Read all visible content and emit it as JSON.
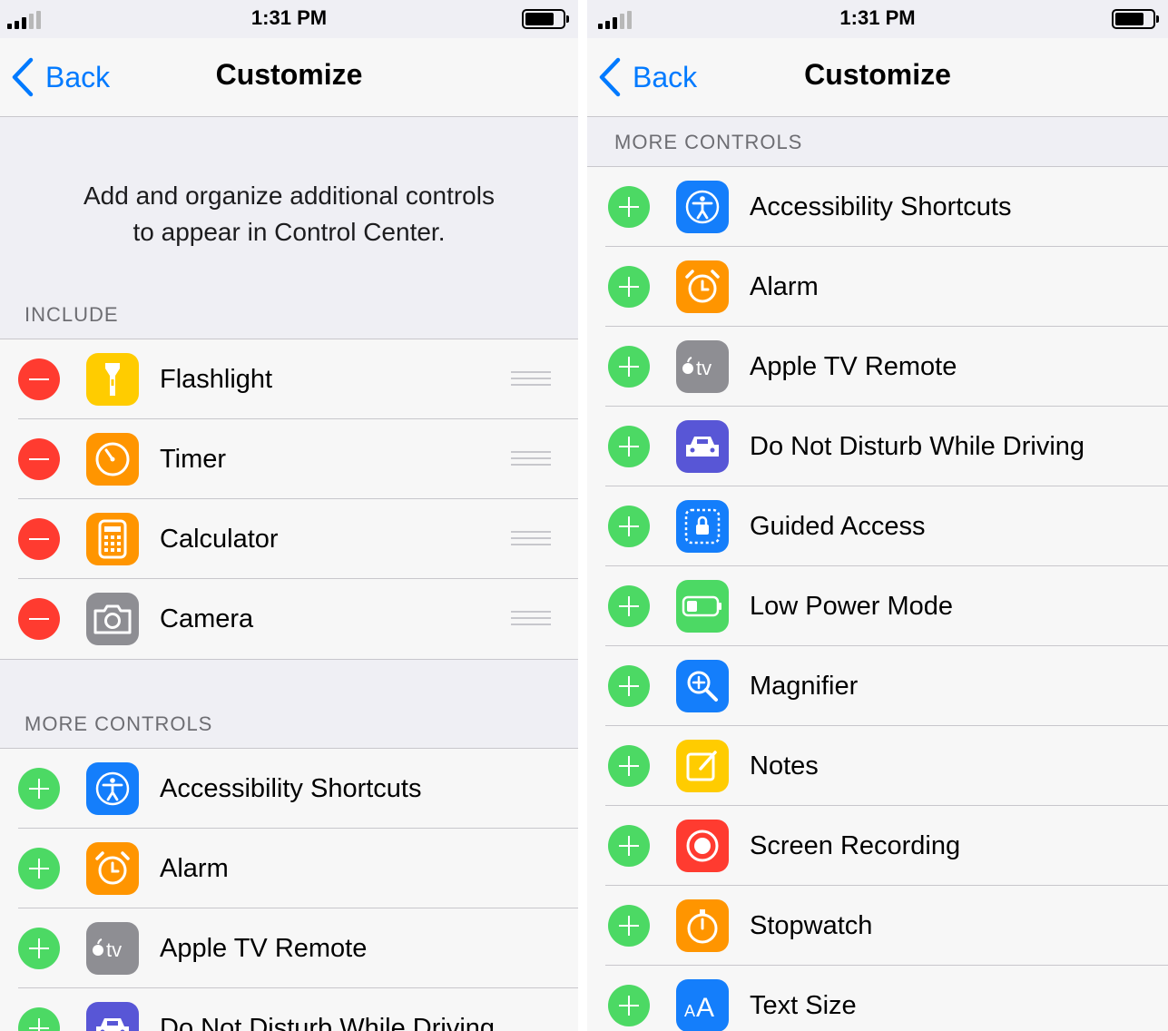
{
  "colors": {
    "accent": "#007aff",
    "remove": "#ff3b30",
    "add": "#4cd964"
  },
  "left": {
    "status": {
      "time": "1:31 PM"
    },
    "nav": {
      "back": "Back",
      "title": "Customize"
    },
    "intro": [
      "Add and organize additional controls",
      "to appear in Control Center."
    ],
    "include_header": "INCLUDE",
    "include": [
      {
        "label": "Flashlight",
        "icon": "flashlight-icon"
      },
      {
        "label": "Timer",
        "icon": "timer-icon"
      },
      {
        "label": "Calculator",
        "icon": "calculator-icon"
      },
      {
        "label": "Camera",
        "icon": "camera-icon"
      }
    ],
    "more_header": "MORE CONTROLS",
    "more": [
      {
        "label": "Accessibility Shortcuts",
        "icon": "accessibility-icon"
      },
      {
        "label": "Alarm",
        "icon": "alarm-icon"
      },
      {
        "label": "Apple TV Remote",
        "icon": "apple-tv-icon"
      },
      {
        "label": "Do Not Disturb While Driving",
        "icon": "car-icon"
      }
    ]
  },
  "right": {
    "status": {
      "time": "1:31 PM"
    },
    "nav": {
      "back": "Back",
      "title": "Customize"
    },
    "more_header": "MORE CONTROLS",
    "more": [
      {
        "label": "Accessibility Shortcuts",
        "icon": "accessibility-icon"
      },
      {
        "label": "Alarm",
        "icon": "alarm-icon"
      },
      {
        "label": "Apple TV Remote",
        "icon": "apple-tv-icon"
      },
      {
        "label": "Do Not Disturb While Driving",
        "icon": "car-icon"
      },
      {
        "label": "Guided Access",
        "icon": "guided-access-icon"
      },
      {
        "label": "Low Power Mode",
        "icon": "low-power-icon"
      },
      {
        "label": "Magnifier",
        "icon": "magnifier-icon"
      },
      {
        "label": "Notes",
        "icon": "notes-icon"
      },
      {
        "label": "Screen Recording",
        "icon": "screen-recording-icon"
      },
      {
        "label": "Stopwatch",
        "icon": "stopwatch-icon"
      },
      {
        "label": "Text Size",
        "icon": "text-size-icon"
      }
    ]
  }
}
